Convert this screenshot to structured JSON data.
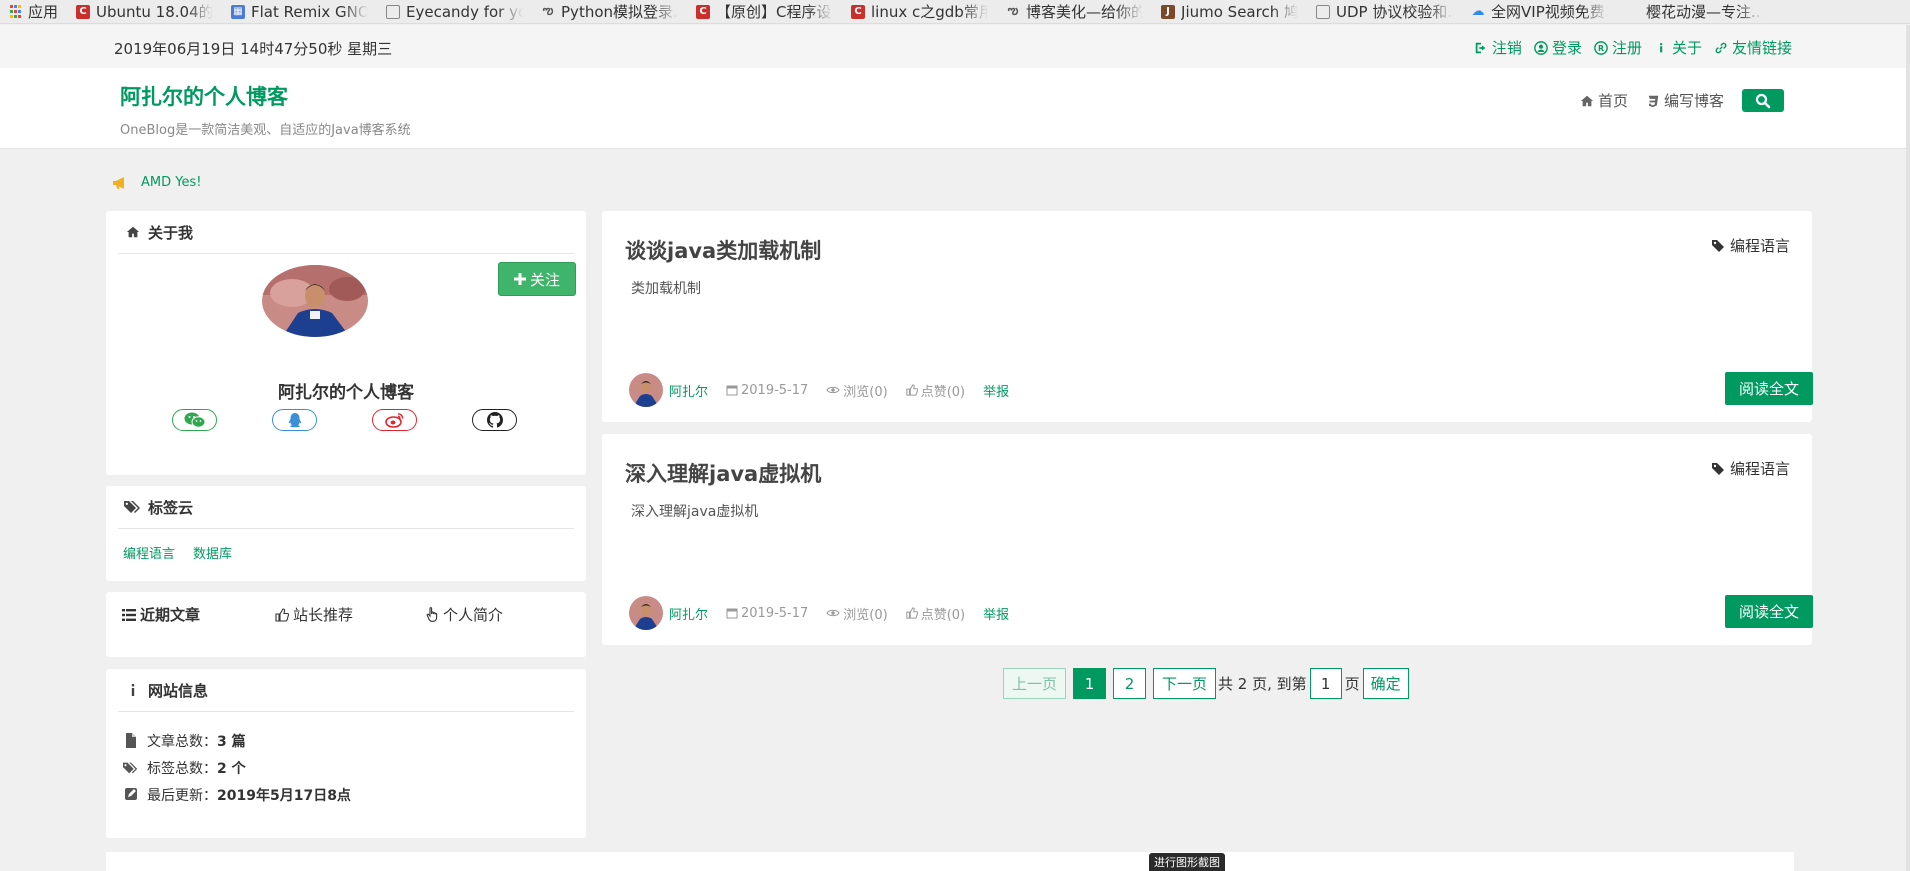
{
  "bookmarks": [
    {
      "label": "应用",
      "icon": "apps-grid-icon",
      "color": "#e8453c"
    },
    {
      "label": "Ubuntu 18.04的...",
      "icon": "csdn-icon",
      "color": "#c9302c"
    },
    {
      "label": "Flat Remix GNO...",
      "icon": "flat-remix-icon",
      "color": "#4a7bd8"
    },
    {
      "label": "Eyecandy for yo...",
      "icon": "page-icon",
      "color": "#888888"
    },
    {
      "label": "Python模拟登录...",
      "icon": "cnblogs-icon",
      "color": "#555555"
    },
    {
      "label": "【原创】C程序设...",
      "icon": "csdn-icon",
      "color": "#c9302c"
    },
    {
      "label": "linux c之gdb常用...",
      "icon": "csdn-icon",
      "color": "#c9302c"
    },
    {
      "label": "博客美化—给你的...",
      "icon": "cnblogs-icon",
      "color": "#555555"
    },
    {
      "label": "Jiumo Search 鸠...",
      "icon": "jiumo-icon",
      "color": "#7a4a2a"
    },
    {
      "label": "UDP 协议校验和...",
      "icon": "page-icon",
      "color": "#888888"
    },
    {
      "label": "全网VIP视频免费...",
      "icon": "cloud-icon",
      "color": "#2d8cf0"
    },
    {
      "label": "樱花动漫—专注...",
      "icon": "blank-icon",
      "color": "#ececec"
    }
  ],
  "topbar": {
    "datetime": "2019年06月19日 14时47分50秒 星期三",
    "links": [
      "注销",
      "登录",
      "注册",
      "关于",
      "友情链接"
    ]
  },
  "header": {
    "title": "阿扎尔的个人博客",
    "subtitle": "OneBlog是一款简洁美观、自适应的Java博客系统",
    "nav_home": "首页",
    "nav_write": "编写博客"
  },
  "notice": {
    "text": "AMD Yes!"
  },
  "about": {
    "heading": "关于我",
    "follow": "关注",
    "name": "阿扎尔的个人博客"
  },
  "tag_cloud": {
    "heading": "标签云",
    "tags": [
      "编程语言",
      "数据库"
    ]
  },
  "tabs": [
    "近期文章",
    "站长推荐",
    "个人简介"
  ],
  "site_info": {
    "heading": "网站信息",
    "rows": [
      {
        "label": "文章总数：",
        "value": "3 篇"
      },
      {
        "label": "标签总数：",
        "value": "2 个"
      },
      {
        "label": "最后更新：",
        "value": "2019年5月17日8点"
      }
    ]
  },
  "articles": [
    {
      "title": "谈谈java类加载机制",
      "category": "编程语言",
      "summary": "类加载机制",
      "author": "阿扎尔",
      "date": "2019-5-17",
      "views": "浏览(0)",
      "likes": "点赞(0)",
      "report": "举报",
      "read_more": "阅读全文"
    },
    {
      "title": "深入理解java虚拟机",
      "category": "编程语言",
      "summary": "深入理解java虚拟机",
      "author": "阿扎尔",
      "date": "2019-5-17",
      "views": "浏览(0)",
      "likes": "点赞(0)",
      "report": "举报",
      "read_more": "阅读全文"
    }
  ],
  "pager": {
    "prev": "上一页",
    "pages": [
      "1",
      "2"
    ],
    "next": "下一页",
    "total_text": "共 2 页, 到第",
    "goto_value": "1",
    "page_suffix": "页",
    "confirm": "确定"
  },
  "tooltip": "进行图形截图",
  "colors": {
    "accent": "#009a61",
    "background": "#f0f0f0"
  }
}
